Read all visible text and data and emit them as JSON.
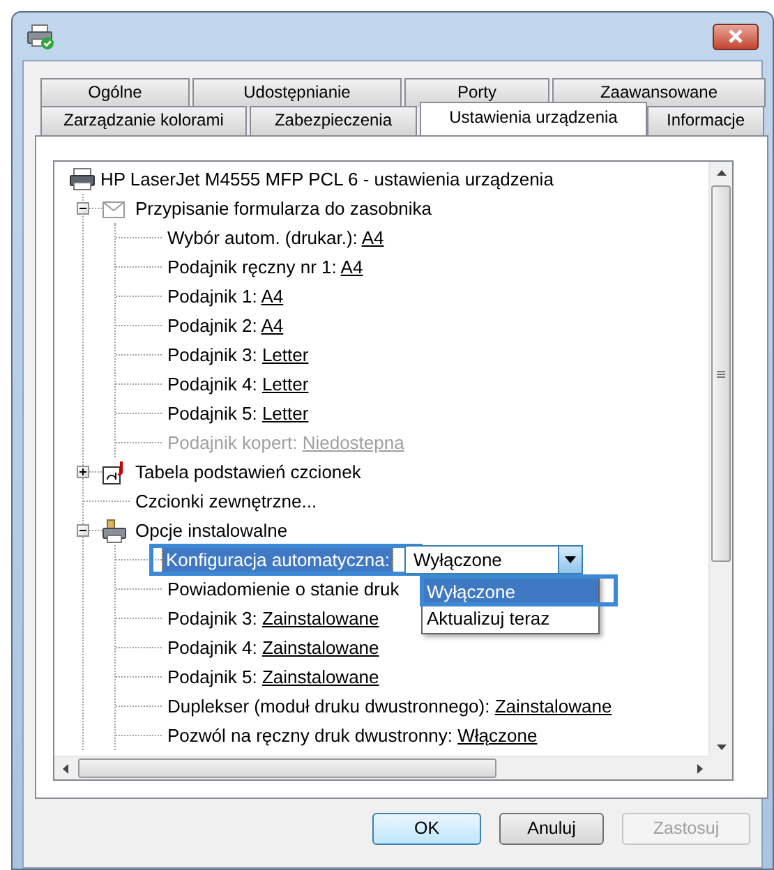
{
  "tabs": [
    [
      {
        "label": "Ogólne",
        "selected": false
      },
      {
        "label": "Udostępnianie",
        "selected": false
      },
      {
        "label": "Porty",
        "selected": false
      },
      {
        "label": "Zaawansowane",
        "selected": false
      }
    ],
    [
      {
        "label": "Zarządzanie kolorami",
        "selected": false
      },
      {
        "label": "Zabezpieczenia",
        "selected": false
      },
      {
        "label": "Ustawienia urządzenia",
        "selected": true
      },
      {
        "label": "Informacje",
        "selected": false
      }
    ]
  ],
  "tree": {
    "label": "HP LaserJet M4555 MFP PCL 6 - ustawienia urządzenia",
    "children": [
      {
        "kind": "group",
        "label": "Przypisanie formularza do zasobnika",
        "expanded": true,
        "children": [
          {
            "kind": "setting",
            "label": "Wybór autom. (drukar.):",
            "value": "A4",
            "disabled": false
          },
          {
            "kind": "setting",
            "label": "Podajnik ręczny nr 1:",
            "value": "A4",
            "disabled": false
          },
          {
            "kind": "setting",
            "label": "Podajnik 1:",
            "value": "A4",
            "disabled": false
          },
          {
            "kind": "setting",
            "label": "Podajnik 2:",
            "value": "A4",
            "disabled": false
          },
          {
            "kind": "setting",
            "label": "Podajnik 3:",
            "value": "Letter",
            "disabled": false
          },
          {
            "kind": "setting",
            "label": "Podajnik 4:",
            "value": "Letter",
            "disabled": false
          },
          {
            "kind": "setting",
            "label": "Podajnik 5:",
            "value": "Letter",
            "disabled": false
          },
          {
            "kind": "setting",
            "label": "Podajnik kopert:",
            "value": "Niedostepna",
            "disabled": true
          }
        ]
      },
      {
        "kind": "group",
        "label": "Tabela podstawień czcionek",
        "expanded": false
      },
      {
        "kind": "link",
        "label": "Czcionki zewnętrzne..."
      },
      {
        "kind": "group",
        "label": "Opcje instalowalne",
        "expanded": true,
        "children": [
          {
            "kind": "combo",
            "label": "Konfiguracja automatyczna:",
            "selected": true,
            "highlighted": true,
            "value": "Wyłączone",
            "open": true,
            "options": [
              {
                "label": "Wyłączone",
                "selected": true,
                "highlighted": true
              },
              {
                "label": "Aktualizuj teraz",
                "selected": false,
                "highlighted": false
              }
            ]
          },
          {
            "kind": "plain",
            "label": "Powiadomienie o stanie druk"
          },
          {
            "kind": "setting",
            "label": "Podajnik 3:",
            "value": "Zainstalowane",
            "disabled": false
          },
          {
            "kind": "setting",
            "label": "Podajnik 4:",
            "value": "Zainstalowane",
            "disabled": false
          },
          {
            "kind": "setting",
            "label": "Podajnik 5:",
            "value": "Zainstalowane",
            "disabled": false
          },
          {
            "kind": "setting",
            "label": "Duplekser (moduł druku dwustronnego):",
            "value": "Zainstalowane",
            "disabled": false
          },
          {
            "kind": "setting",
            "label": "Pozwól na ręczny druk dwustronny:",
            "value": "Włączone",
            "disabled": false
          }
        ]
      }
    ]
  },
  "buttons": [
    {
      "label": "OK",
      "default": true,
      "disabled": false
    },
    {
      "label": "Anuluj",
      "default": false,
      "disabled": false
    },
    {
      "label": "Zastosuj",
      "default": false,
      "disabled": true
    }
  ]
}
